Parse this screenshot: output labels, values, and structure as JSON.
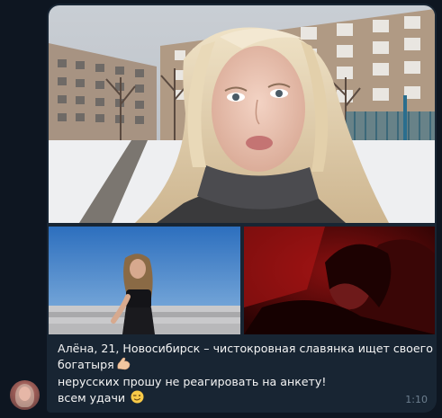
{
  "message": {
    "caption_lines": [
      "Алёна, 21, Новосибирск – чистокровная славянка ищет своего",
      "богатыря",
      "нерусских прошу не реагировать на анкету!",
      "всем удачи"
    ],
    "time": "1:10",
    "emojis": [
      "flexed-biceps-emoji",
      "winking-face-emoji"
    ]
  },
  "media": [
    {
      "name": "selfie-winter-photo"
    },
    {
      "name": "beach-photo"
    },
    {
      "name": "red-light-photo"
    }
  ],
  "colors": {
    "background": "#0e1621",
    "bubble": "#182533",
    "text": "#f5f5f5",
    "time": "#6d7f8f"
  }
}
